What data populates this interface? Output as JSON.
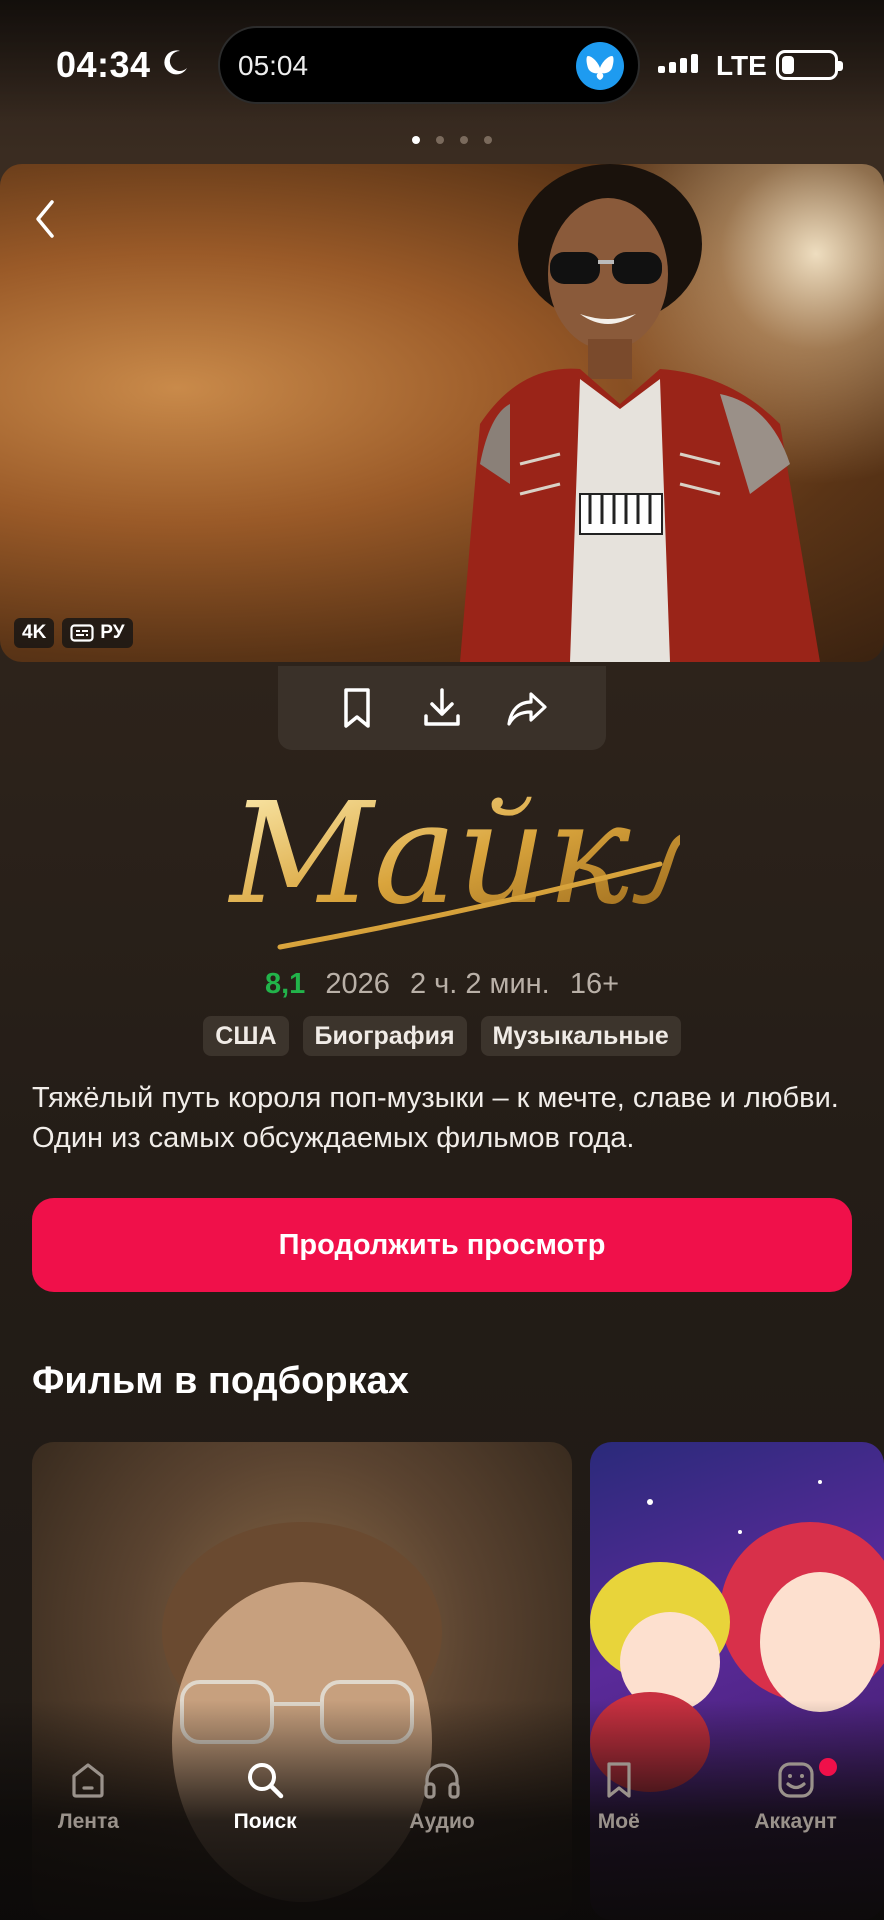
{
  "status_bar": {
    "clock": "04:34",
    "island_time": "05:04",
    "network": "LTE"
  },
  "pager": {
    "count": 4,
    "active": 0
  },
  "hero": {
    "badge_quality": "4K",
    "badge_audio": "РУ"
  },
  "movie": {
    "title_logo": "Майкл",
    "rating": "8,1",
    "rating_color": "#22b34a",
    "year": "2026",
    "duration": "2 ч. 2 мин.",
    "age": "16+",
    "tags": [
      "США",
      "Биография",
      "Музыкальные"
    ],
    "description": "Тяжёлый путь короля поп-музыки – к мечте, славе и любви. Один из самых обсуждаемых фильмов года."
  },
  "cta": {
    "label": "Продолжить просмотр",
    "color": "#f0104a"
  },
  "collections": {
    "title": "Фильм в подборках"
  },
  "nav": {
    "items": [
      {
        "label": "Лента",
        "icon": "home-icon"
      },
      {
        "label": "Поиск",
        "icon": "search-icon"
      },
      {
        "label": "Аудио",
        "icon": "headphones-icon"
      },
      {
        "label": "Моё",
        "icon": "bookmark-icon"
      },
      {
        "label": "Аккаунт",
        "icon": "account-icon"
      }
    ],
    "active": 1
  }
}
